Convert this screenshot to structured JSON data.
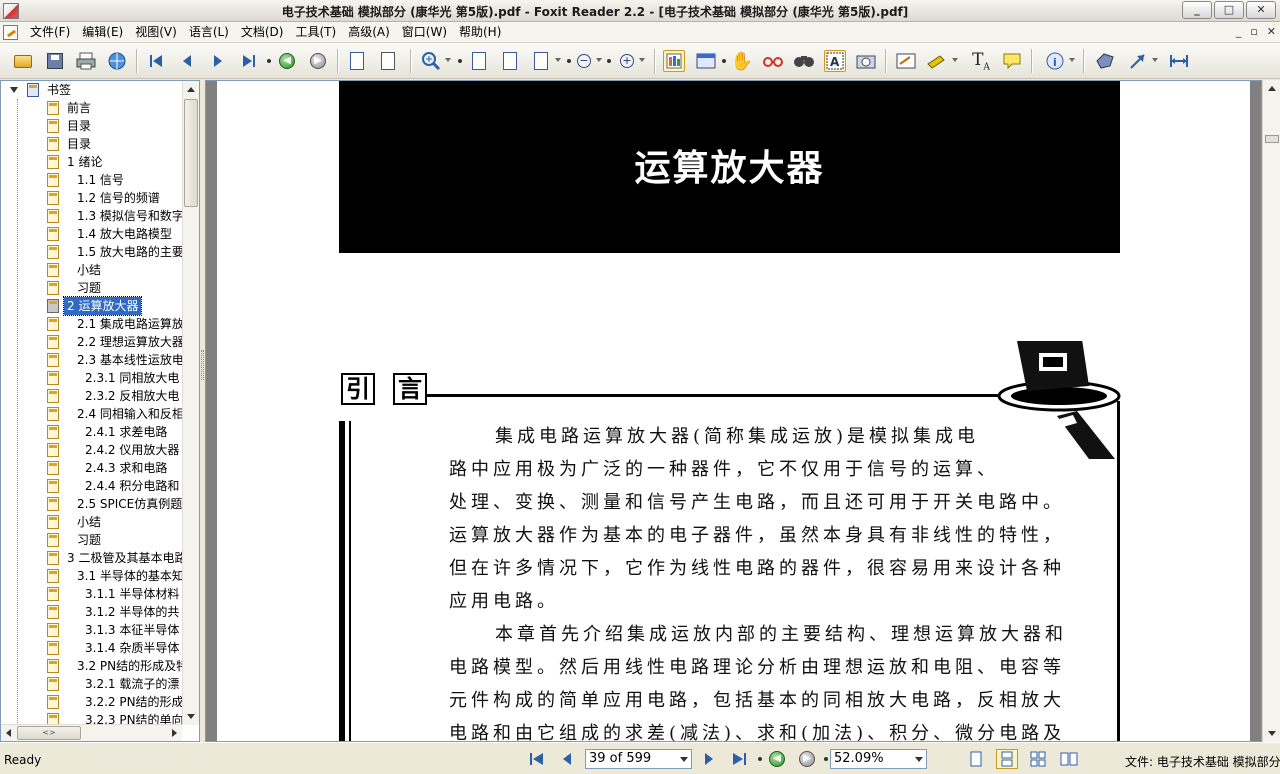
{
  "window": {
    "title": "电子技术基础 模拟部分 (康华光 第5版).pdf - Foxit Reader 2.2 - [电子技术基础 模拟部分 (康华光 第5版).pdf]",
    "minimize": "_",
    "maximize": "□",
    "close": "✕"
  },
  "menu": {
    "items": [
      "文件(F)",
      "编辑(E)",
      "视图(V)",
      "语言(L)",
      "文档(D)",
      "工具(T)",
      "高级(A)",
      "窗口(W)",
      "帮助(H)"
    ],
    "mdi_minimize": "_",
    "mdi_restore": "▫",
    "mdi_close": "✕"
  },
  "toolbar": {
    "icons": [
      "open-icon",
      "save-icon",
      "print-icon",
      "web-icon",
      "first-page-icon",
      "prev-page-icon",
      "next-page-icon",
      "last-page-icon",
      "back-icon",
      "forward-icon",
      "extract-icon",
      "rotate-icon",
      "zoom-in-icon",
      "actual-size-icon",
      "fit-page-icon",
      "fit-width-icon",
      "zoom-out-icon",
      "zoom-plus-icon",
      "bookmarks-icon",
      "properties-icon",
      "hand-icon",
      "glasses-icon",
      "find-icon",
      "select-text-icon",
      "snapshot-icon",
      "typewriter-icon",
      "highlight-icon",
      "text-tool-icon",
      "note-icon",
      "info-icon",
      "shape-icon",
      "arrow-icon",
      "measure-icon"
    ]
  },
  "sidebar": {
    "root_label": "书签",
    "selected_label": "2  运算放大器",
    "items": [
      {
        "label": "前言",
        "level": 1
      },
      {
        "label": "目录",
        "level": 1
      },
      {
        "label": "目录",
        "level": 1
      },
      {
        "label": "1  绪论",
        "level": 1
      },
      {
        "label": "1.1  信号",
        "level": 2
      },
      {
        "label": "1.2  信号的频谱",
        "level": 2
      },
      {
        "label": "1.3  模拟信号和数字",
        "level": 2
      },
      {
        "label": "1.4  放大电路模型",
        "level": 2
      },
      {
        "label": "1.5  放大电路的主要",
        "level": 2
      },
      {
        "label": "小结",
        "level": 2
      },
      {
        "label": "习题",
        "level": 2
      },
      {
        "label": "2  运算放大器",
        "level": 1
      },
      {
        "label": "2.1  集成电路运算放",
        "level": 2
      },
      {
        "label": "2.2  理想运算放大器",
        "level": 2
      },
      {
        "label": "2.3  基本线性运放电",
        "level": 2
      },
      {
        "label": "2.3.1  同相放大电",
        "level": 3
      },
      {
        "label": "2.3.2  反相放大电",
        "level": 3
      },
      {
        "label": "2.4  同相输入和反相",
        "level": 2
      },
      {
        "label": "2.4.1  求差电路",
        "level": 3
      },
      {
        "label": "2.4.2  仪用放大器",
        "level": 3
      },
      {
        "label": "2.4.3  求和电路",
        "level": 3
      },
      {
        "label": "2.4.4  积分电路和",
        "level": 3
      },
      {
        "label": "2.5  SPICE仿真例题",
        "level": 2
      },
      {
        "label": "小结",
        "level": 2
      },
      {
        "label": "习题",
        "level": 2
      },
      {
        "label": "3  二极管及其基本电路",
        "level": 1
      },
      {
        "label": "3.1  半导体的基本知",
        "level": 2
      },
      {
        "label": "3.1.1  半导体材料",
        "level": 3
      },
      {
        "label": "3.1.2  半导体的共",
        "level": 3
      },
      {
        "label": "3.1.3  本征半导体",
        "level": 3
      },
      {
        "label": "3.1.4  杂质半导体",
        "level": 3
      },
      {
        "label": "3.2  PN结的形成及特",
        "level": 2
      },
      {
        "label": "3.2.1  载流子的漂",
        "level": 3
      },
      {
        "label": "3.2.2  PN结的形成",
        "level": 3
      },
      {
        "label": "3.2.3  PN结的单向",
        "level": 3
      }
    ]
  },
  "document": {
    "chapter_title": "运算放大器",
    "intro_char1": "引",
    "intro_char2": "言",
    "paragraphs": [
      "集成电路运算放大器(简称集成运放)是模拟集成电",
      "路中应用极为广泛的一种器件，它不仅用于信号的运算、",
      "处理、变换、测量和信号产生电路，而且还可用于开关电路中。",
      "运算放大器作为基本的电子器件，虽然本身具有非线性的特性，",
      "但在许多情况下，它作为线性电路的器件，很容易用来设计各种",
      "应用电路。",
      "本章首先介绍集成运放内部的主要结构、理想运算放大器和",
      "电路模型。然后用线性电路理论分析由理想运放和电阻、电容等",
      "元件构成的简单应用电路，包括基本的同相放大电路，反相放大",
      "电路和由它组成的求差(减法)、求和(加法)、积分、微分电路及"
    ]
  },
  "status": {
    "ready": "Ready",
    "page": "39 of 599",
    "zoom": "52.09%",
    "file": "文件: 电子技术基础 模拟部分"
  }
}
